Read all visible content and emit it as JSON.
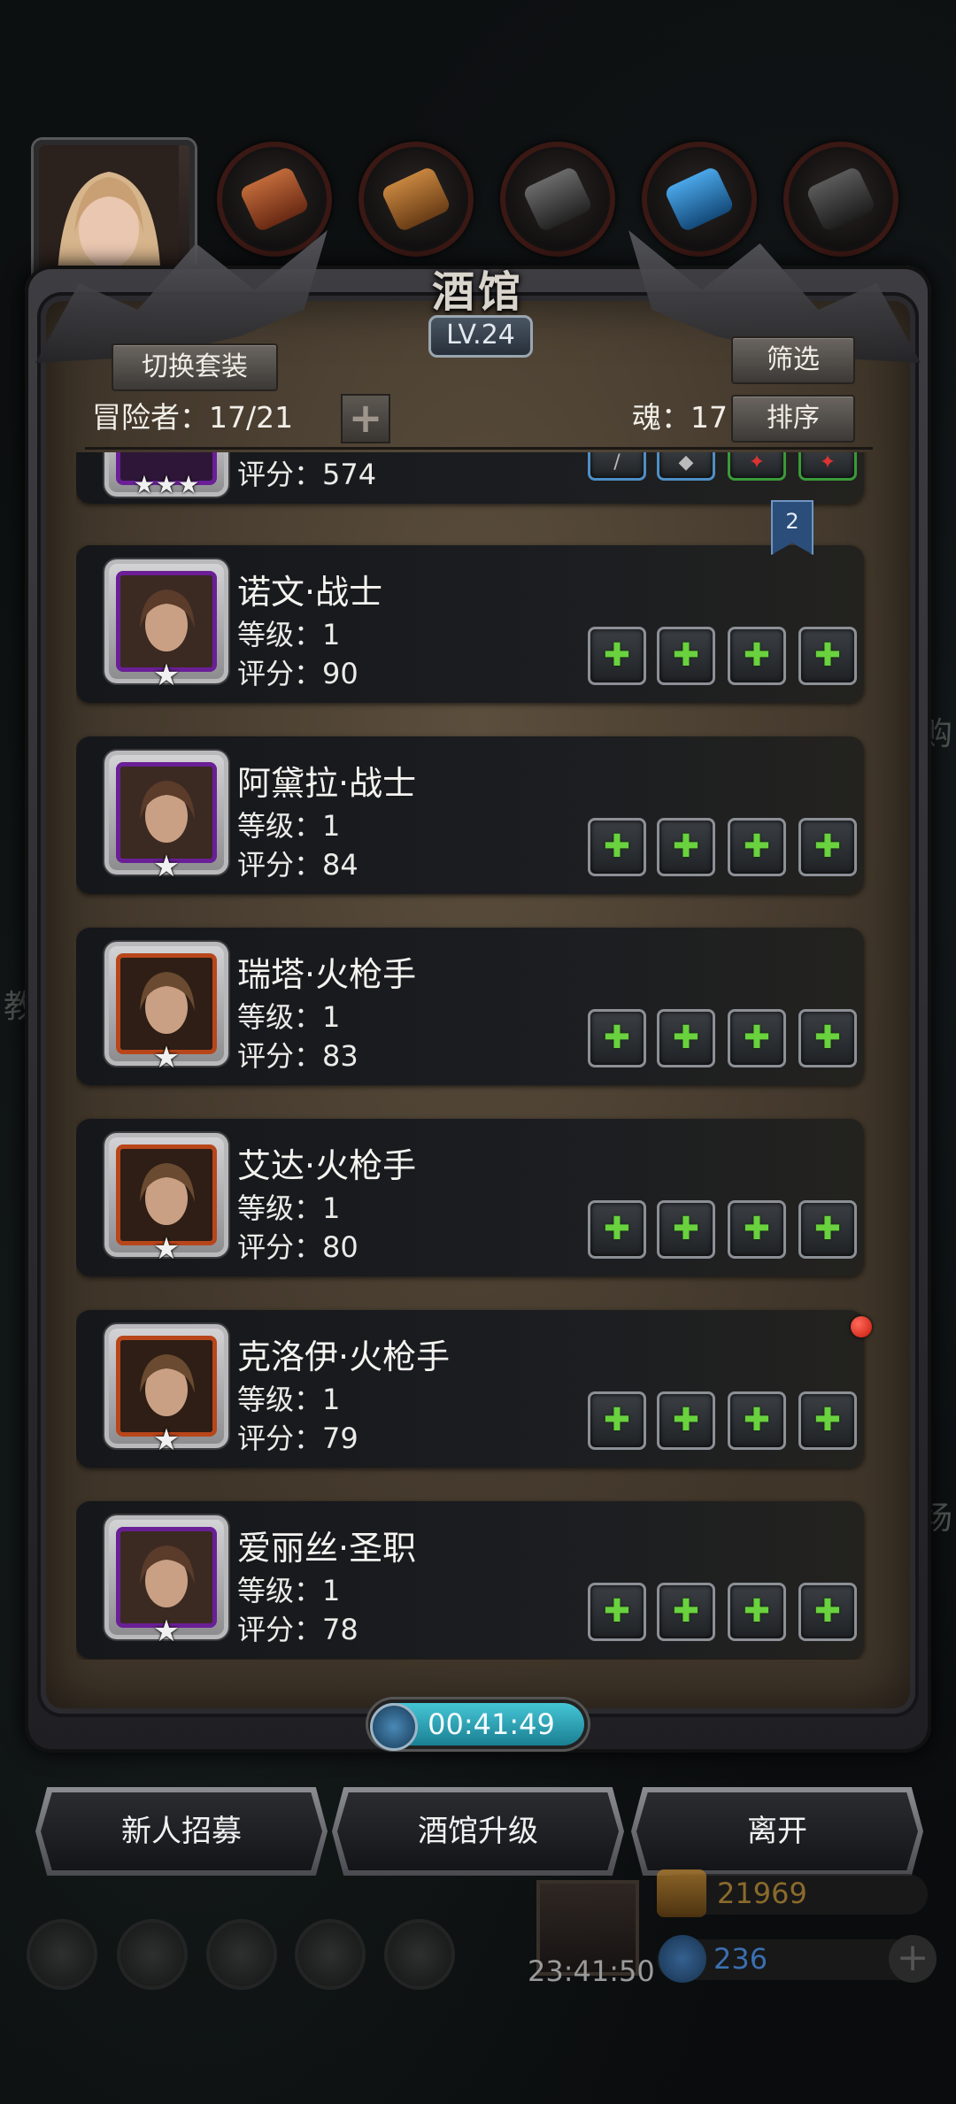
{
  "colors": {
    "panel_bg": "#463b2e",
    "card_bg": "#17191c",
    "accent_green": "#69d23e",
    "timer": "#2ab0c4",
    "gold": "#d9a24a",
    "blue": "#4a88d0",
    "red_dot": "#e0241a"
  },
  "panel": {
    "title": "酒馆",
    "level": "LV.24",
    "switch_outfit_label": "切换套装",
    "filter_label": "筛选",
    "sort_label": "排序",
    "adventurers": "冒险者：17/21",
    "souls": "魂：17",
    "add_icon": "plus-icon"
  },
  "partial_card": {
    "score": "评分：574",
    "stars": "★★★",
    "bookmark": "2"
  },
  "heroes": [
    {
      "name": "诺文·战士",
      "level": "等级：1",
      "score": "评分：90",
      "frame": "purple",
      "star": "★"
    },
    {
      "name": "阿黛拉·战士",
      "level": "等级：1",
      "score": "评分：84",
      "frame": "purple",
      "star": "★"
    },
    {
      "name": "瑞塔·火枪手",
      "level": "等级：1",
      "score": "评分：83",
      "frame": "orange",
      "star": "★"
    },
    {
      "name": "艾达·火枪手",
      "level": "等级：1",
      "score": "评分：80",
      "frame": "orange",
      "star": "★"
    },
    {
      "name": "克洛伊·火枪手",
      "level": "等级：1",
      "score": "评分：79",
      "frame": "orange",
      "star": "★"
    },
    {
      "name": "爱丽丝·圣职",
      "level": "等级：1",
      "score": "评分：78",
      "frame": "purple",
      "star": "★"
    }
  ],
  "equip_add_glyph": "✚",
  "timer": "00:41:49",
  "buttons": {
    "recruit": "新人招募",
    "upgrade": "酒馆升级",
    "leave": "离开"
  },
  "hud": {
    "gift_timer": "23:41:50",
    "gold": "21969",
    "gems": "236"
  },
  "side_hints": {
    "left": "教",
    "right1": "购",
    "right2": "场"
  }
}
